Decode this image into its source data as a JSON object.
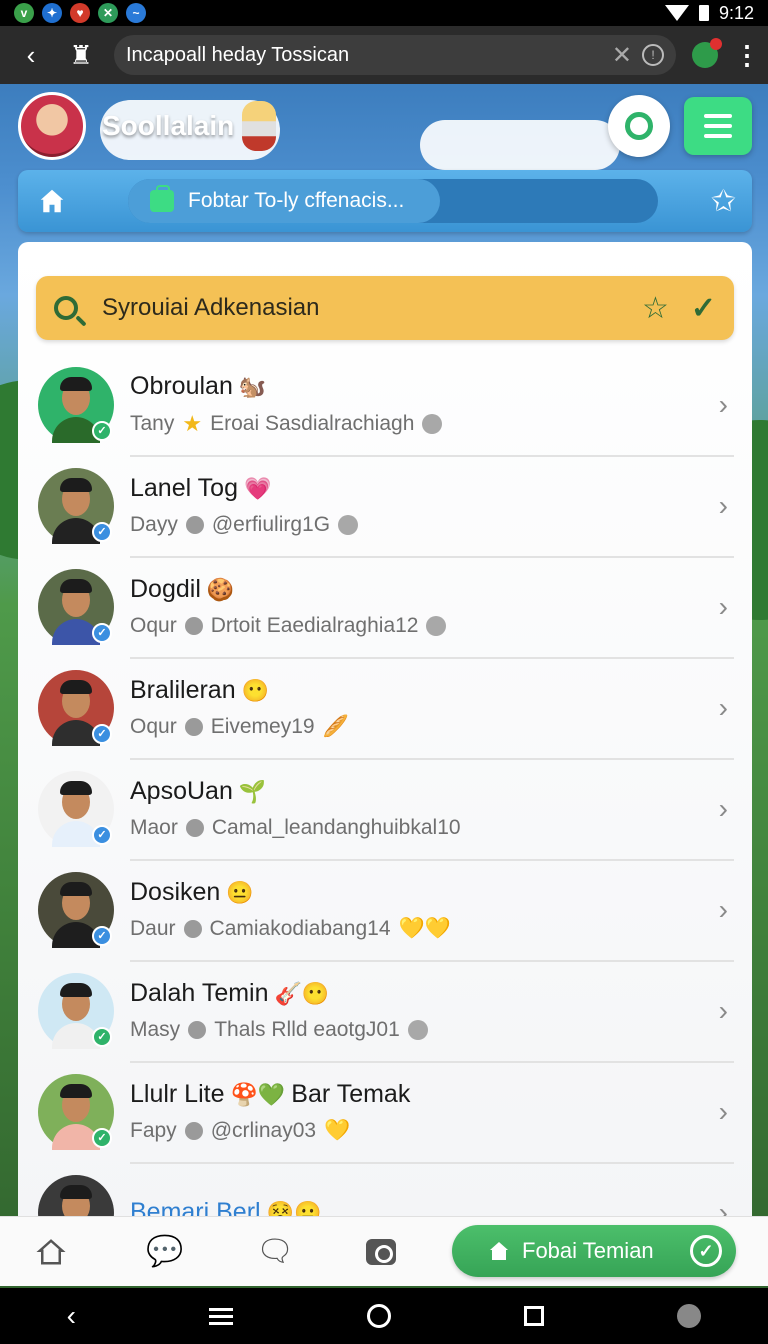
{
  "statusbar": {
    "time": "9:12",
    "app_icons": [
      {
        "glyph": "v",
        "color": "#3aa04a"
      },
      {
        "glyph": "✦",
        "color": "#1f6fd0"
      },
      {
        "glyph": "♥",
        "color": "#d23a2a"
      },
      {
        "glyph": "✕",
        "color": "#2e9b5a"
      },
      {
        "glyph": "~",
        "color": "#2a7ad8"
      }
    ]
  },
  "browser": {
    "url": "Incapoall heday Tossican"
  },
  "header": {
    "app_name": "Soollalain"
  },
  "nav": {
    "pill_label": "Fobtar To-ly cffenacis..."
  },
  "search": {
    "label": "Syrouiai Adkenasian"
  },
  "contacts": [
    {
      "name": "Obroulan",
      "name_emoji": "🐿️",
      "sub_prefix": "Tany",
      "sub_icon": "star",
      "sub_text": "Eroai Sasdialrachiagh",
      "tail": "●",
      "avatar_bg": "#2fb36a",
      "shirt": "#2a6a2a",
      "badge_color": "#2fb36a",
      "badge": "✓"
    },
    {
      "name": "Lanel Tog",
      "name_emoji": "💗",
      "sub_prefix": "Dayy",
      "sub_icon": "at",
      "sub_text": "@erfiulirg1G",
      "tail": "●",
      "avatar_bg": "#6a7d52",
      "shirt": "#222222",
      "badge_color": "#3b8fe0",
      "badge": "✓"
    },
    {
      "name": "Dogdil",
      "name_emoji": "🍪",
      "sub_prefix": "Oqur",
      "sub_icon": "at",
      "sub_text": "Drtoit Eaedialraghia12",
      "tail": "●",
      "avatar_bg": "#5b6b49",
      "shirt": "#3c55a8",
      "badge_color": "#3b8fe0",
      "badge": "✓"
    },
    {
      "name": "Bralileran",
      "name_emoji": "😶",
      "sub_prefix": "Oqur",
      "sub_icon": "at",
      "sub_text": "Eivemey19",
      "tail": "🥖",
      "avatar_bg": "#b6453a",
      "shirt": "#2e2e2e",
      "badge_color": "#3b8fe0",
      "badge": "✓"
    },
    {
      "name": "ApsoUan",
      "name_emoji": "🌱",
      "sub_prefix": "Maor",
      "sub_icon": "at",
      "sub_text": "Camal_leandanghuibkal10",
      "tail": "",
      "avatar_bg": "#f2f2f2",
      "shirt": "#e6f0fb",
      "badge_color": "#3b8fe0",
      "badge": "✓"
    },
    {
      "name": "Dosiken",
      "name_emoji": "😐",
      "sub_prefix": "Daur",
      "sub_icon": "at",
      "sub_text": "Camiakodiabang14",
      "tail": "💛💛",
      "avatar_bg": "#4a4a3a",
      "shirt": "#1e1e1e",
      "badge_color": "#3b8fe0",
      "badge": "✓"
    },
    {
      "name": "Dalah Temin",
      "name_emoji": "🎸😶",
      "sub_prefix": "Masy",
      "sub_icon": "at",
      "sub_text": "Thals Rlld eaotgJ01",
      "tail": "●",
      "avatar_bg": "#cfe8f4",
      "shirt": "#f0f0f0",
      "badge_color": "#2fb36a",
      "badge": "✓"
    },
    {
      "name": "Llulr Lite",
      "name_emoji": "🍄💚",
      "name_extra": "Bar Temak",
      "sub_prefix": "Fapy",
      "sub_icon": "at",
      "sub_text": "@crlinay03",
      "tail": "💛",
      "avatar_bg": "#7fb05a",
      "shirt": "#f1b5a8",
      "badge_color": "#2fb36a",
      "badge": "✓"
    },
    {
      "name": "Bemari Berl",
      "name_emoji": "😵😐",
      "sub_prefix": "",
      "sub_icon": "",
      "sub_text": "",
      "tail": "",
      "avatar_bg": "#3a3a3a",
      "shirt": "#b02a2a",
      "badge_color": "#3b8fe0",
      "badge": "✓",
      "name_color": "#2f7fd0"
    }
  ],
  "tabbar": {
    "cta_label": "Fobai Temian"
  }
}
